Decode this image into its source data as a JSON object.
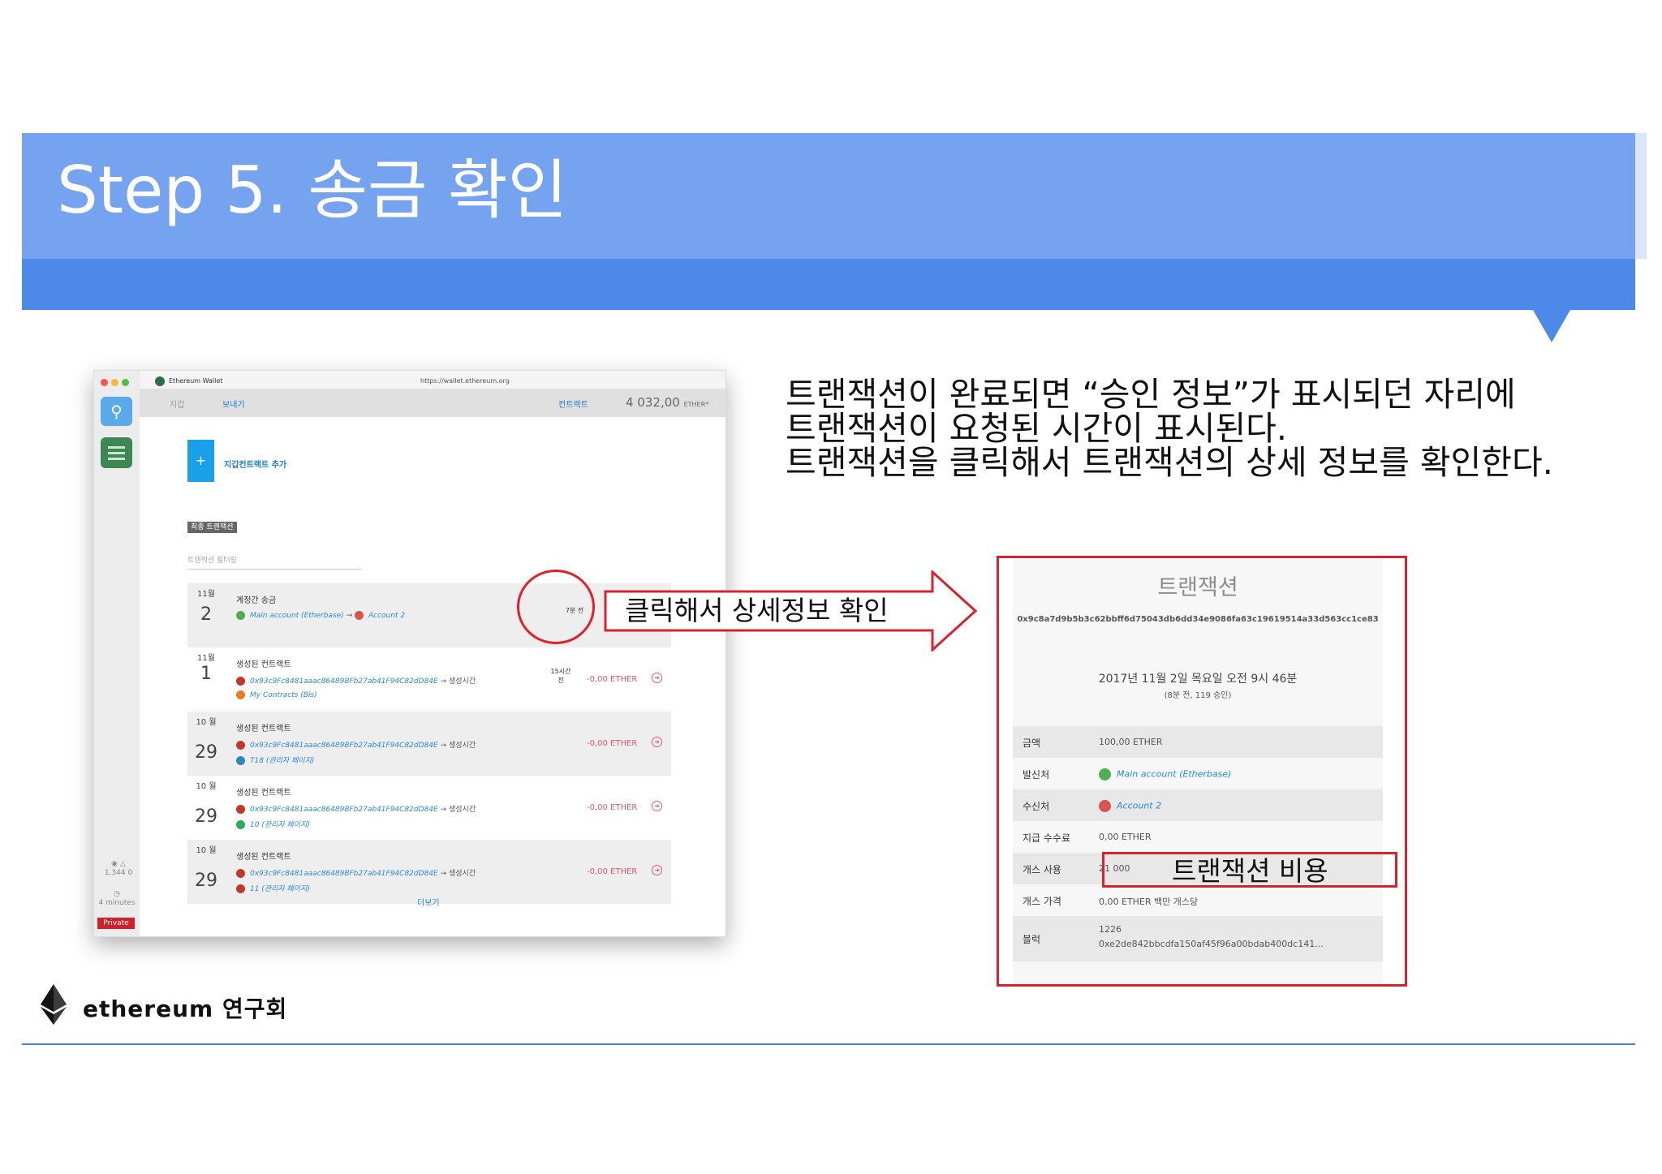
{
  "slide": {
    "title": "Step 5. 송금 확인",
    "description": [
      "트랜잭션이 완료되면 “승인 정보”가 표시되던 자리에",
      "트랜잭션이 요청된 시간이 표시된다.",
      "트랜잭션을 클릭해서 트랜잭션의 상세 정보를 확인한다."
    ],
    "footer_brand": "ethereum",
    "footer_suffix": "연구회",
    "annotation_click": "클릭해서 상세정보 확인",
    "annotation_gas": "트랜잭션 비용"
  },
  "wallet": {
    "app_name": "Ethereum Wallet",
    "url": "https://wallet.ethereum.org",
    "tabs": [
      "지갑",
      "보내기",
      "컨트랙트"
    ],
    "balance": "4 032,00",
    "balance_unit": "ETHER*",
    "add_contract": "지갑컨트랙트 추가",
    "section_label": "최종 트랜잭션",
    "filter_placeholder": "트랜잭션 필터링",
    "peers": "1,344",
    "peers_pending": "0",
    "block_time": "4 minutes",
    "network": "Private",
    "more": "더보기",
    "transactions": [
      {
        "month": "11월",
        "day": "2",
        "title": "계정간 송금",
        "line1": "Main account (Etherbase)",
        "arrow": "→",
        "line1b": "Account 2",
        "line2": "",
        "amount": "",
        "ago": "7분 전"
      },
      {
        "month": "11월",
        "day": "1",
        "title": "생성된 컨트랙트",
        "line1": "0x93c9Fc8481aaac86489BFb27ab41F94C82dD84E",
        "arrow": "→",
        "line1b": "생성시간",
        "line2": "My Contracts (Bis)",
        "amount": "-0,00 ETHER",
        "ago": "15시간 전"
      },
      {
        "month": "10 월",
        "day": "29",
        "title": "생성된 컨트랙트",
        "line1": "0x93c9Fc8481aaac86489BFb27ab41F94C82dD84E",
        "arrow": "→",
        "line1b": "생성시간",
        "line2": "T18 (관리자 페이지)",
        "amount": "-0,00 ETHER",
        "ago": ""
      },
      {
        "month": "10 월",
        "day": "29",
        "title": "생성된 컨트랙트",
        "line1": "0x93c9Fc8481aaac86489BFb27ab41F94C82dD84E",
        "arrow": "→",
        "line1b": "생성시간",
        "line2": "10 (관리자 페이지)",
        "amount": "-0,00 ETHER",
        "ago": ""
      },
      {
        "month": "10 월",
        "day": "29",
        "title": "생성된 컨트랙트",
        "line1": "0x93c9Fc8481aaac86489BFb27ab41F94C82dD84E",
        "arrow": "→",
        "line1b": "생성시간",
        "line2": "11 (관리자 페이지)",
        "amount": "-0,00 ETHER",
        "ago": ""
      }
    ]
  },
  "detail": {
    "title": "트랜잭션",
    "hash": "0x9c8a7d9b5b3c62bbff6d75043db6dd34e9086fa63c19619514a33d563cc1ce83",
    "date": "2017년 11월 2일 목요일 오전 9시 46분",
    "sub": "(8분 전, 119 승인)",
    "rows": [
      {
        "key": "금액",
        "value": "100,00 ETHER"
      },
      {
        "key": "발신처",
        "value": "Main account (Etherbase)"
      },
      {
        "key": "수신처",
        "value": "Account 2"
      },
      {
        "key": "지급 수수료",
        "value": "0,00 ETHER"
      },
      {
        "key": "개스 사용",
        "value": "21 000"
      },
      {
        "key": "개스 가격",
        "value": "0,00 ETHER 백만 개스당"
      },
      {
        "key": "블럭",
        "value": "1226",
        "value2": "0xe2de842bbcdfa150af45f96a00bdab400dc141..."
      }
    ]
  },
  "colors": {
    "header_light": "#75a3ef",
    "header_dark": "#4d89e8",
    "annotation_red": "#d7232f",
    "link_blue": "#2a8ae0"
  }
}
